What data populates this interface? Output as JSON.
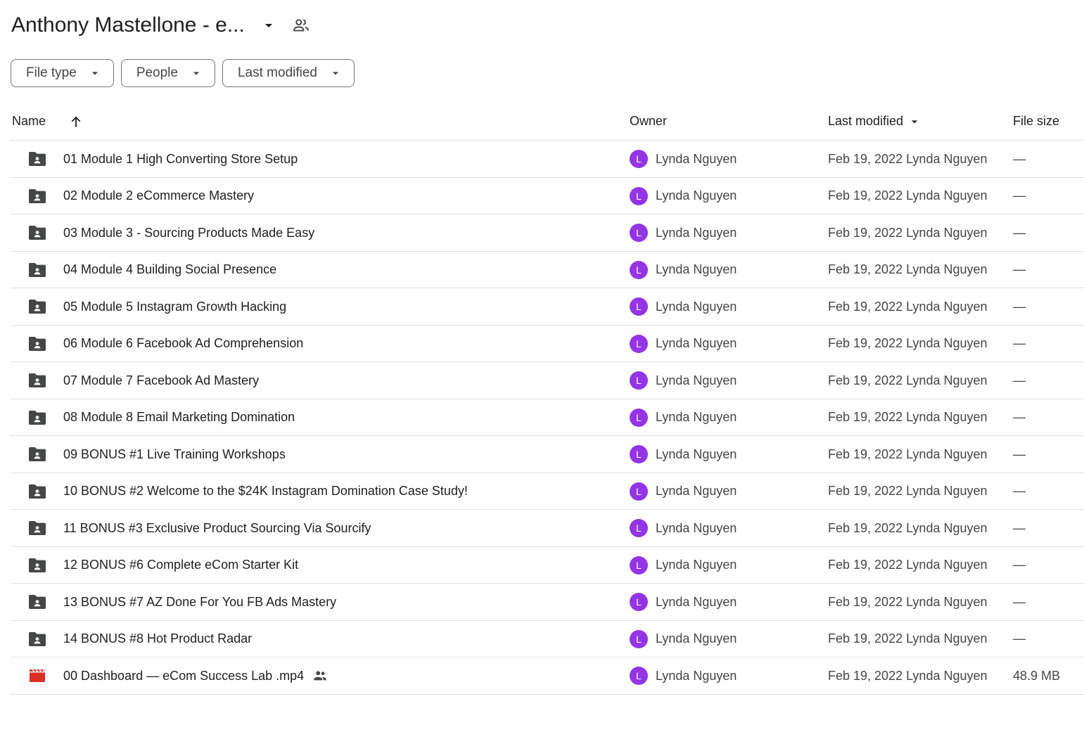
{
  "header": {
    "title": "Anthony Mastellone - e...",
    "caret_icon": "arrow-drop-down-icon",
    "shared_icon": "people-outline-icon"
  },
  "filters": [
    {
      "label": "File type"
    },
    {
      "label": "People"
    },
    {
      "label": "Last modified"
    }
  ],
  "columns": {
    "name": "Name",
    "owner": "Owner",
    "last_modified": "Last modified",
    "file_size": "File size"
  },
  "colors": {
    "avatar": "#9334e6",
    "folder_icon": "#444746",
    "video_icon": "#d93025",
    "divider": "#e0e0e0"
  },
  "rows": [
    {
      "type": "folder",
      "name": "01 Module 1 High Converting Store Setup",
      "owner_initial": "L",
      "owner": "Lynda Nguyen",
      "modified": "Feb 19, 2022 Lynda Nguyen",
      "size": "—"
    },
    {
      "type": "folder",
      "name": "02 Module 2 eCommerce Mastery",
      "owner_initial": "L",
      "owner": "Lynda Nguyen",
      "modified": "Feb 19, 2022 Lynda Nguyen",
      "size": "—"
    },
    {
      "type": "folder",
      "name": "03 Module 3 - Sourcing Products Made Easy",
      "owner_initial": "L",
      "owner": "Lynda Nguyen",
      "modified": "Feb 19, 2022 Lynda Nguyen",
      "size": "—"
    },
    {
      "type": "folder",
      "name": "04 Module 4 Building Social Presence",
      "owner_initial": "L",
      "owner": "Lynda Nguyen",
      "modified": "Feb 19, 2022 Lynda Nguyen",
      "size": "—"
    },
    {
      "type": "folder",
      "name": "05 Module 5 Instagram Growth Hacking",
      "owner_initial": "L",
      "owner": "Lynda Nguyen",
      "modified": "Feb 19, 2022 Lynda Nguyen",
      "size": "—"
    },
    {
      "type": "folder",
      "name": "06 Module 6 Facebook Ad Comprehension",
      "owner_initial": "L",
      "owner": "Lynda Nguyen",
      "modified": "Feb 19, 2022 Lynda Nguyen",
      "size": "—"
    },
    {
      "type": "folder",
      "name": "07 Module 7 Facebook Ad Mastery",
      "owner_initial": "L",
      "owner": "Lynda Nguyen",
      "modified": "Feb 19, 2022 Lynda Nguyen",
      "size": "—"
    },
    {
      "type": "folder",
      "name": "08 Module 8 Email Marketing Domination",
      "owner_initial": "L",
      "owner": "Lynda Nguyen",
      "modified": "Feb 19, 2022 Lynda Nguyen",
      "size": "—"
    },
    {
      "type": "folder",
      "name": "09 BONUS #1 Live Training Workshops",
      "owner_initial": "L",
      "owner": "Lynda Nguyen",
      "modified": "Feb 19, 2022 Lynda Nguyen",
      "size": "—"
    },
    {
      "type": "folder",
      "name": "10  BONUS #2 Welcome to the $24K Instagram Domination Case Study!",
      "owner_initial": "L",
      "owner": "Lynda Nguyen",
      "modified": "Feb 19, 2022 Lynda Nguyen",
      "size": "—"
    },
    {
      "type": "folder",
      "name": "11 BONUS #3 Exclusive Product Sourcing Via Sourcify",
      "owner_initial": "L",
      "owner": "Lynda Nguyen",
      "modified": "Feb 19, 2022 Lynda Nguyen",
      "size": "—"
    },
    {
      "type": "folder",
      "name": "12 BONUS #6 Complete eCom Starter Kit",
      "owner_initial": "L",
      "owner": "Lynda Nguyen",
      "modified": "Feb 19, 2022 Lynda Nguyen",
      "size": "—"
    },
    {
      "type": "folder",
      "name": "13 BONUS #7 AZ Done For You FB Ads Mastery",
      "owner_initial": "L",
      "owner": "Lynda Nguyen",
      "modified": "Feb 19, 2022 Lynda Nguyen",
      "size": "—"
    },
    {
      "type": "folder",
      "name": "14 BONUS #8 Hot Product Radar",
      "owner_initial": "L",
      "owner": "Lynda Nguyen",
      "modified": "Feb 19, 2022 Lynda Nguyen",
      "size": "—"
    },
    {
      "type": "video",
      "name": "00 Dashboard — eCom Success Lab .mp4",
      "shared": true,
      "owner_initial": "L",
      "owner": "Lynda Nguyen",
      "modified": "Feb 19, 2022 Lynda Nguyen",
      "size": "48.9 MB"
    }
  ]
}
